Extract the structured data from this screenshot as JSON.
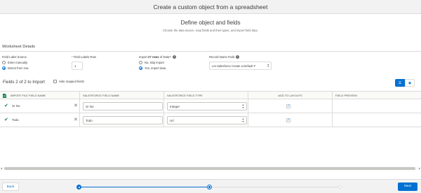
{
  "window": {
    "title": "Create a custom object from a spreadsheet"
  },
  "header": {
    "title": "Define object and fields",
    "subtitle": "Choose the data source, map fields and their types, and import field data."
  },
  "worksheet": {
    "section_title": "Worksheet Details",
    "field_label_source": {
      "label": "Field Label Source",
      "options": [
        "Enter manually",
        "Detect from row"
      ],
      "selected": "Detect from row"
    },
    "field_labels_row": {
      "required_mark": "*",
      "label": "Field Labels Row",
      "value": "1"
    },
    "import_rows": {
      "label_prefix": "Import ",
      "label_bold": "27 rows",
      "label_suffix": " of Data?",
      "options": [
        "No, skip import",
        "Yes, import data"
      ],
      "selected": "Yes, import data"
    },
    "record_name_field": {
      "label": "Record Name Field",
      "value": "Let Salesforce Create a Default F"
    }
  },
  "fields": {
    "heading": "Fields 2 of 2 to Import",
    "hide_mapped_label": "Hide mapped fields",
    "columns": [
      "Import File Field Name",
      "Salesforce Field Name",
      "Salesforce Field Type",
      "Add to Layouts",
      "Field Preview"
    ],
    "rows": [
      {
        "import_name": "Sr No",
        "sf_name": "Sr No",
        "sf_type": "Integer",
        "add_to_layout": true
      },
      {
        "import_name": "Todo",
        "sf_name": "Todo",
        "sf_type": "Url",
        "add_to_layout": true
      }
    ]
  },
  "footer": {
    "back_label": "Back",
    "next_label": "Next",
    "progress_fraction": 0.5,
    "steps": [
      "done",
      "active",
      "todo"
    ]
  },
  "icons": {
    "check": "✔",
    "remove": "✕",
    "sheet": "spreadsheet-icon",
    "list_view": "list-icon",
    "preview": "eye-icon"
  },
  "colors": {
    "brand": "#0070d2",
    "success": "#04844b"
  }
}
